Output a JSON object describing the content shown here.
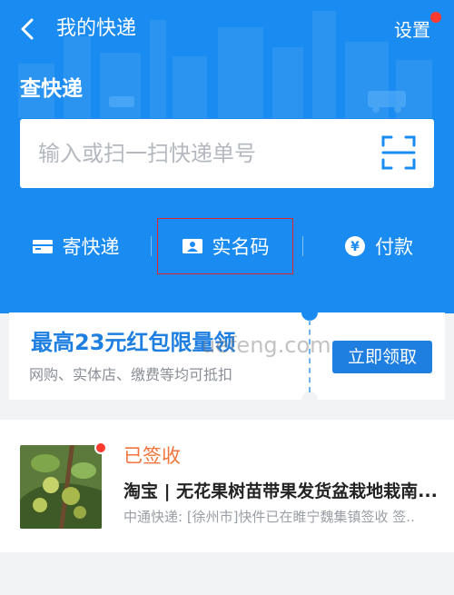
{
  "header": {
    "title": "我的快递",
    "settings_label": "设置",
    "section_title": "查快递",
    "colors": {
      "background": "#1a8bf0",
      "notification_dot": "#ff3b30"
    }
  },
  "search": {
    "placeholder": "输入或扫一扫快递单号",
    "scan_icon": "scan-icon"
  },
  "actions": [
    {
      "label": "寄快递",
      "icon": "send-package-icon"
    },
    {
      "label": "实名码",
      "icon": "id-card-icon"
    },
    {
      "label": "付款",
      "icon": "yen-icon"
    }
  ],
  "coupon": {
    "title": "最高23元红包限量领",
    "subtitle": "网购、实体店、缴费等均可抵扣",
    "button_label": "立即领取",
    "watermark": "uefeng.com",
    "colors": {
      "accent": "#1f7fe0"
    }
  },
  "package": {
    "status": "已签收",
    "title": "淘宝 | 无花果树苗带果发货盆栽地栽南...",
    "description": "中通快递: [徐州市]快件已在睢宁魏集镇签收 签..",
    "colors": {
      "status": "#f0743c"
    }
  }
}
